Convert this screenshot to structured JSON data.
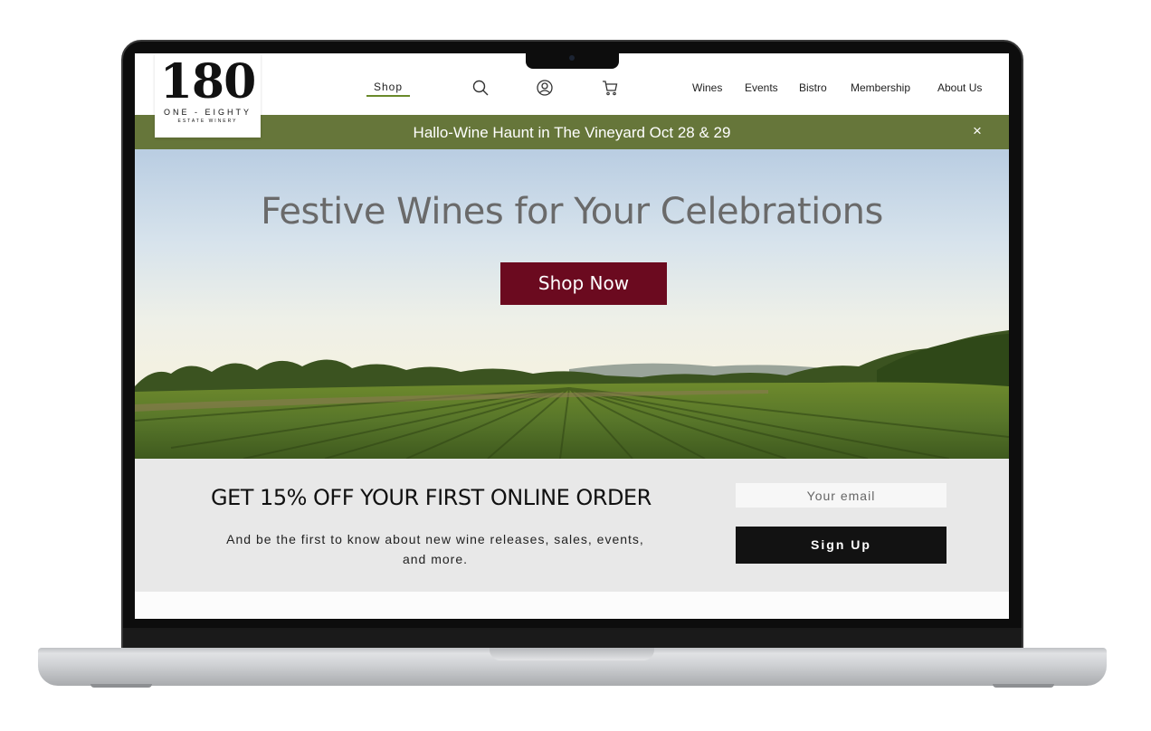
{
  "logo": {
    "number": "180",
    "name": "ONE - EIGHTY",
    "tagline": "ESTATE WINERY"
  },
  "nav": {
    "shop_label": "Shop",
    "icons": [
      "search-icon",
      "account-icon",
      "cart-icon"
    ],
    "links": [
      "Wines",
      "Events",
      "Bistro",
      "Membership",
      "About Us"
    ]
  },
  "announcement": {
    "text": "Hallo-Wine Haunt in The Vineyard Oct 28 & 29",
    "close": "×"
  },
  "hero": {
    "title": "Festive Wines for Your Celebrations",
    "button": "Shop Now"
  },
  "signup": {
    "title": "GET 15% OFF YOUR FIRST ONLINE ORDER",
    "description": "And be the first to know about new wine releases, sales, events, and more.",
    "email_placeholder": "Your email",
    "button": "Sign Up"
  },
  "colors": {
    "brand_green": "#66763a",
    "accent_burgundy": "#6b0a1f",
    "button_dark": "#121212"
  }
}
